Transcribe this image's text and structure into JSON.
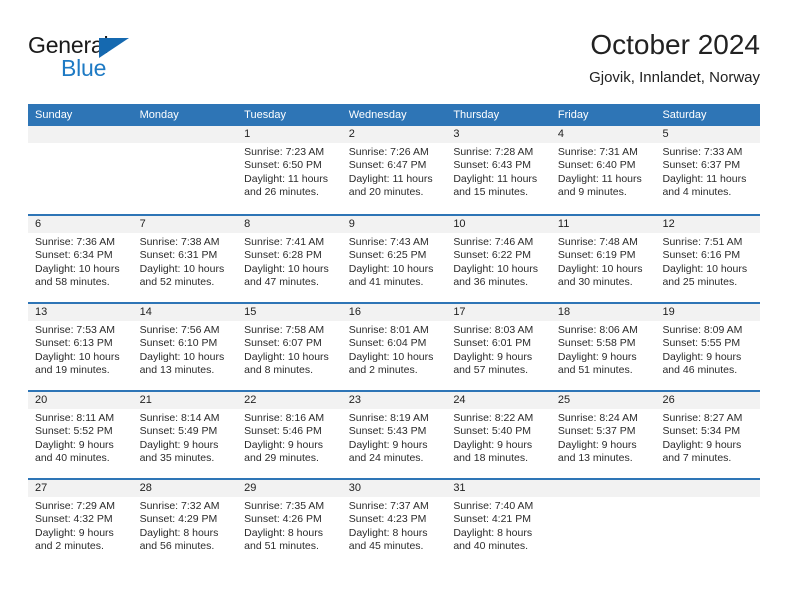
{
  "brand": {
    "name_top": "General",
    "name_bottom": "Blue",
    "triangle_icon": "blue-triangle-logo-icon",
    "color_dark": "#1a1a1a",
    "color_blue": "#1e7ac4"
  },
  "header": {
    "title": "October 2024",
    "subtitle": "Gjovik, Innlandet, Norway"
  },
  "theme": {
    "accent": "#2e75b6",
    "band": "#f2f2f2",
    "text": "#222222"
  },
  "calendar": {
    "weekdays": [
      "Sunday",
      "Monday",
      "Tuesday",
      "Wednesday",
      "Thursday",
      "Friday",
      "Saturday"
    ],
    "labels": {
      "sunrise": "Sunrise:",
      "sunset": "Sunset:",
      "daylight": "Daylight:"
    },
    "weeks": [
      [
        {
          "day": ""
        },
        {
          "day": ""
        },
        {
          "day": "1",
          "sunrise": "Sunrise: 7:23 AM",
          "sunset": "Sunset: 6:50 PM",
          "daylight": "Daylight: 11 hours and 26 minutes."
        },
        {
          "day": "2",
          "sunrise": "Sunrise: 7:26 AM",
          "sunset": "Sunset: 6:47 PM",
          "daylight": "Daylight: 11 hours and 20 minutes."
        },
        {
          "day": "3",
          "sunrise": "Sunrise: 7:28 AM",
          "sunset": "Sunset: 6:43 PM",
          "daylight": "Daylight: 11 hours and 15 minutes."
        },
        {
          "day": "4",
          "sunrise": "Sunrise: 7:31 AM",
          "sunset": "Sunset: 6:40 PM",
          "daylight": "Daylight: 11 hours and 9 minutes."
        },
        {
          "day": "5",
          "sunrise": "Sunrise: 7:33 AM",
          "sunset": "Sunset: 6:37 PM",
          "daylight": "Daylight: 11 hours and 4 minutes."
        }
      ],
      [
        {
          "day": "6",
          "sunrise": "Sunrise: 7:36 AM",
          "sunset": "Sunset: 6:34 PM",
          "daylight": "Daylight: 10 hours and 58 minutes."
        },
        {
          "day": "7",
          "sunrise": "Sunrise: 7:38 AM",
          "sunset": "Sunset: 6:31 PM",
          "daylight": "Daylight: 10 hours and 52 minutes."
        },
        {
          "day": "8",
          "sunrise": "Sunrise: 7:41 AM",
          "sunset": "Sunset: 6:28 PM",
          "daylight": "Daylight: 10 hours and 47 minutes."
        },
        {
          "day": "9",
          "sunrise": "Sunrise: 7:43 AM",
          "sunset": "Sunset: 6:25 PM",
          "daylight": "Daylight: 10 hours and 41 minutes."
        },
        {
          "day": "10",
          "sunrise": "Sunrise: 7:46 AM",
          "sunset": "Sunset: 6:22 PM",
          "daylight": "Daylight: 10 hours and 36 minutes."
        },
        {
          "day": "11",
          "sunrise": "Sunrise: 7:48 AM",
          "sunset": "Sunset: 6:19 PM",
          "daylight": "Daylight: 10 hours and 30 minutes."
        },
        {
          "day": "12",
          "sunrise": "Sunrise: 7:51 AM",
          "sunset": "Sunset: 6:16 PM",
          "daylight": "Daylight: 10 hours and 25 minutes."
        }
      ],
      [
        {
          "day": "13",
          "sunrise": "Sunrise: 7:53 AM",
          "sunset": "Sunset: 6:13 PM",
          "daylight": "Daylight: 10 hours and 19 minutes."
        },
        {
          "day": "14",
          "sunrise": "Sunrise: 7:56 AM",
          "sunset": "Sunset: 6:10 PM",
          "daylight": "Daylight: 10 hours and 13 minutes."
        },
        {
          "day": "15",
          "sunrise": "Sunrise: 7:58 AM",
          "sunset": "Sunset: 6:07 PM",
          "daylight": "Daylight: 10 hours and 8 minutes."
        },
        {
          "day": "16",
          "sunrise": "Sunrise: 8:01 AM",
          "sunset": "Sunset: 6:04 PM",
          "daylight": "Daylight: 10 hours and 2 minutes."
        },
        {
          "day": "17",
          "sunrise": "Sunrise: 8:03 AM",
          "sunset": "Sunset: 6:01 PM",
          "daylight": "Daylight: 9 hours and 57 minutes."
        },
        {
          "day": "18",
          "sunrise": "Sunrise: 8:06 AM",
          "sunset": "Sunset: 5:58 PM",
          "daylight": "Daylight: 9 hours and 51 minutes."
        },
        {
          "day": "19",
          "sunrise": "Sunrise: 8:09 AM",
          "sunset": "Sunset: 5:55 PM",
          "daylight": "Daylight: 9 hours and 46 minutes."
        }
      ],
      [
        {
          "day": "20",
          "sunrise": "Sunrise: 8:11 AM",
          "sunset": "Sunset: 5:52 PM",
          "daylight": "Daylight: 9 hours and 40 minutes."
        },
        {
          "day": "21",
          "sunrise": "Sunrise: 8:14 AM",
          "sunset": "Sunset: 5:49 PM",
          "daylight": "Daylight: 9 hours and 35 minutes."
        },
        {
          "day": "22",
          "sunrise": "Sunrise: 8:16 AM",
          "sunset": "Sunset: 5:46 PM",
          "daylight": "Daylight: 9 hours and 29 minutes."
        },
        {
          "day": "23",
          "sunrise": "Sunrise: 8:19 AM",
          "sunset": "Sunset: 5:43 PM",
          "daylight": "Daylight: 9 hours and 24 minutes."
        },
        {
          "day": "24",
          "sunrise": "Sunrise: 8:22 AM",
          "sunset": "Sunset: 5:40 PM",
          "daylight": "Daylight: 9 hours and 18 minutes."
        },
        {
          "day": "25",
          "sunrise": "Sunrise: 8:24 AM",
          "sunset": "Sunset: 5:37 PM",
          "daylight": "Daylight: 9 hours and 13 minutes."
        },
        {
          "day": "26",
          "sunrise": "Sunrise: 8:27 AM",
          "sunset": "Sunset: 5:34 PM",
          "daylight": "Daylight: 9 hours and 7 minutes."
        }
      ],
      [
        {
          "day": "27",
          "sunrise": "Sunrise: 7:29 AM",
          "sunset": "Sunset: 4:32 PM",
          "daylight": "Daylight: 9 hours and 2 minutes."
        },
        {
          "day": "28",
          "sunrise": "Sunrise: 7:32 AM",
          "sunset": "Sunset: 4:29 PM",
          "daylight": "Daylight: 8 hours and 56 minutes."
        },
        {
          "day": "29",
          "sunrise": "Sunrise: 7:35 AM",
          "sunset": "Sunset: 4:26 PM",
          "daylight": "Daylight: 8 hours and 51 minutes."
        },
        {
          "day": "30",
          "sunrise": "Sunrise: 7:37 AM",
          "sunset": "Sunset: 4:23 PM",
          "daylight": "Daylight: 8 hours and 45 minutes."
        },
        {
          "day": "31",
          "sunrise": "Sunrise: 7:40 AM",
          "sunset": "Sunset: 4:21 PM",
          "daylight": "Daylight: 8 hours and 40 minutes."
        },
        {
          "day": ""
        },
        {
          "day": ""
        }
      ]
    ]
  }
}
